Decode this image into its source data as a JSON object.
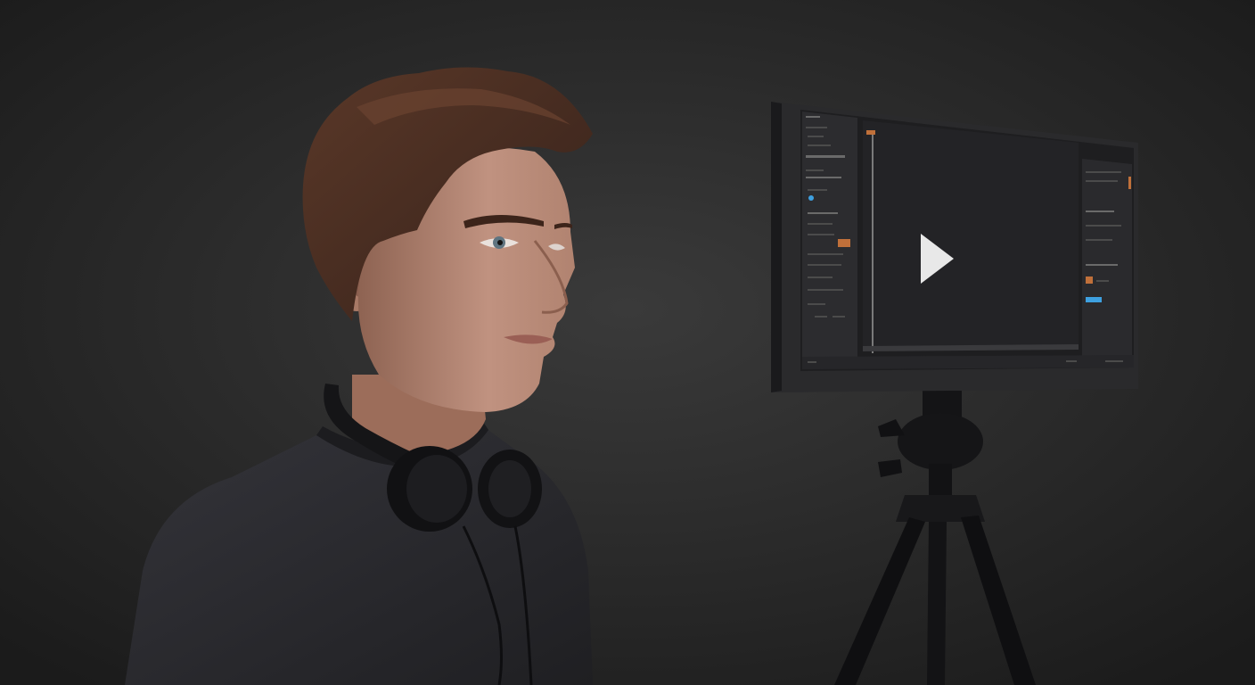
{
  "scene": {
    "subject": "person",
    "prop": "monitor-on-tripod",
    "screen_icon": "play-icon",
    "colors": {
      "background": "#262626",
      "shirt": "#2b2b2e",
      "hair": "#4a2e22",
      "skin": "#b98a74",
      "monitor_frame": "#2a2a2c",
      "screen": "#1e1e20",
      "play_icon": "#e8e8e8",
      "accent_orange": "#c0703a",
      "accent_blue": "#3ea0e0"
    }
  }
}
